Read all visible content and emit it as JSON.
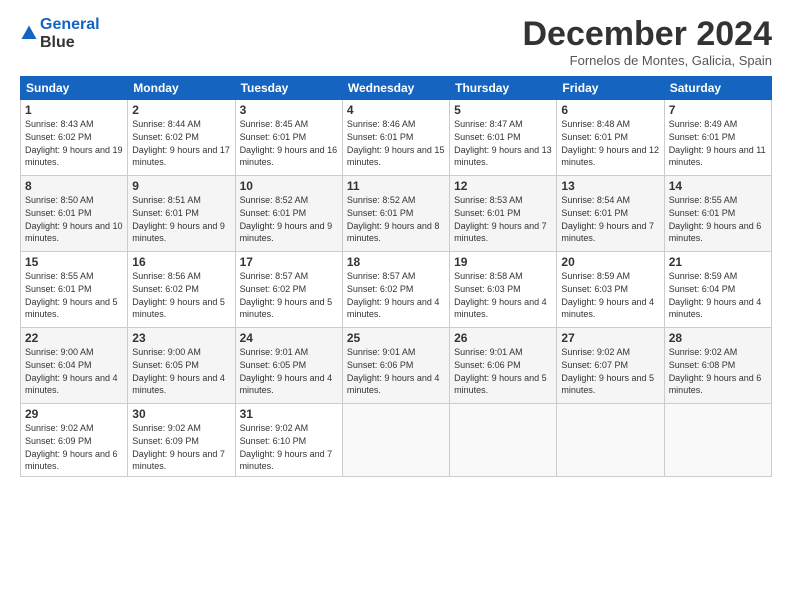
{
  "header": {
    "logo_line1": "General",
    "logo_line2": "Blue",
    "month": "December 2024",
    "location": "Fornelos de Montes, Galicia, Spain"
  },
  "weekdays": [
    "Sunday",
    "Monday",
    "Tuesday",
    "Wednesday",
    "Thursday",
    "Friday",
    "Saturday"
  ],
  "weeks": [
    [
      {
        "day": "1",
        "sunrise": "8:43 AM",
        "sunset": "6:02 PM",
        "daylight": "9 hours and 19 minutes."
      },
      {
        "day": "2",
        "sunrise": "8:44 AM",
        "sunset": "6:02 PM",
        "daylight": "9 hours and 17 minutes."
      },
      {
        "day": "3",
        "sunrise": "8:45 AM",
        "sunset": "6:01 PM",
        "daylight": "9 hours and 16 minutes."
      },
      {
        "day": "4",
        "sunrise": "8:46 AM",
        "sunset": "6:01 PM",
        "daylight": "9 hours and 15 minutes."
      },
      {
        "day": "5",
        "sunrise": "8:47 AM",
        "sunset": "6:01 PM",
        "daylight": "9 hours and 13 minutes."
      },
      {
        "day": "6",
        "sunrise": "8:48 AM",
        "sunset": "6:01 PM",
        "daylight": "9 hours and 12 minutes."
      },
      {
        "day": "7",
        "sunrise": "8:49 AM",
        "sunset": "6:01 PM",
        "daylight": "9 hours and 11 minutes."
      }
    ],
    [
      {
        "day": "8",
        "sunrise": "8:50 AM",
        "sunset": "6:01 PM",
        "daylight": "9 hours and 10 minutes."
      },
      {
        "day": "9",
        "sunrise": "8:51 AM",
        "sunset": "6:01 PM",
        "daylight": "9 hours and 9 minutes."
      },
      {
        "day": "10",
        "sunrise": "8:52 AM",
        "sunset": "6:01 PM",
        "daylight": "9 hours and 9 minutes."
      },
      {
        "day": "11",
        "sunrise": "8:52 AM",
        "sunset": "6:01 PM",
        "daylight": "9 hours and 8 minutes."
      },
      {
        "day": "12",
        "sunrise": "8:53 AM",
        "sunset": "6:01 PM",
        "daylight": "9 hours and 7 minutes."
      },
      {
        "day": "13",
        "sunrise": "8:54 AM",
        "sunset": "6:01 PM",
        "daylight": "9 hours and 7 minutes."
      },
      {
        "day": "14",
        "sunrise": "8:55 AM",
        "sunset": "6:01 PM",
        "daylight": "9 hours and 6 minutes."
      }
    ],
    [
      {
        "day": "15",
        "sunrise": "8:55 AM",
        "sunset": "6:01 PM",
        "daylight": "9 hours and 5 minutes."
      },
      {
        "day": "16",
        "sunrise": "8:56 AM",
        "sunset": "6:02 PM",
        "daylight": "9 hours and 5 minutes."
      },
      {
        "day": "17",
        "sunrise": "8:57 AM",
        "sunset": "6:02 PM",
        "daylight": "9 hours and 5 minutes."
      },
      {
        "day": "18",
        "sunrise": "8:57 AM",
        "sunset": "6:02 PM",
        "daylight": "9 hours and 4 minutes."
      },
      {
        "day": "19",
        "sunrise": "8:58 AM",
        "sunset": "6:03 PM",
        "daylight": "9 hours and 4 minutes."
      },
      {
        "day": "20",
        "sunrise": "8:59 AM",
        "sunset": "6:03 PM",
        "daylight": "9 hours and 4 minutes."
      },
      {
        "day": "21",
        "sunrise": "8:59 AM",
        "sunset": "6:04 PM",
        "daylight": "9 hours and 4 minutes."
      }
    ],
    [
      {
        "day": "22",
        "sunrise": "9:00 AM",
        "sunset": "6:04 PM",
        "daylight": "9 hours and 4 minutes."
      },
      {
        "day": "23",
        "sunrise": "9:00 AM",
        "sunset": "6:05 PM",
        "daylight": "9 hours and 4 minutes."
      },
      {
        "day": "24",
        "sunrise": "9:01 AM",
        "sunset": "6:05 PM",
        "daylight": "9 hours and 4 minutes."
      },
      {
        "day": "25",
        "sunrise": "9:01 AM",
        "sunset": "6:06 PM",
        "daylight": "9 hours and 4 minutes."
      },
      {
        "day": "26",
        "sunrise": "9:01 AM",
        "sunset": "6:06 PM",
        "daylight": "9 hours and 5 minutes."
      },
      {
        "day": "27",
        "sunrise": "9:02 AM",
        "sunset": "6:07 PM",
        "daylight": "9 hours and 5 minutes."
      },
      {
        "day": "28",
        "sunrise": "9:02 AM",
        "sunset": "6:08 PM",
        "daylight": "9 hours and 6 minutes."
      }
    ],
    [
      {
        "day": "29",
        "sunrise": "9:02 AM",
        "sunset": "6:09 PM",
        "daylight": "9 hours and 6 minutes."
      },
      {
        "day": "30",
        "sunrise": "9:02 AM",
        "sunset": "6:09 PM",
        "daylight": "9 hours and 7 minutes."
      },
      {
        "day": "31",
        "sunrise": "9:02 AM",
        "sunset": "6:10 PM",
        "daylight": "9 hours and 7 minutes."
      },
      null,
      null,
      null,
      null
    ]
  ]
}
